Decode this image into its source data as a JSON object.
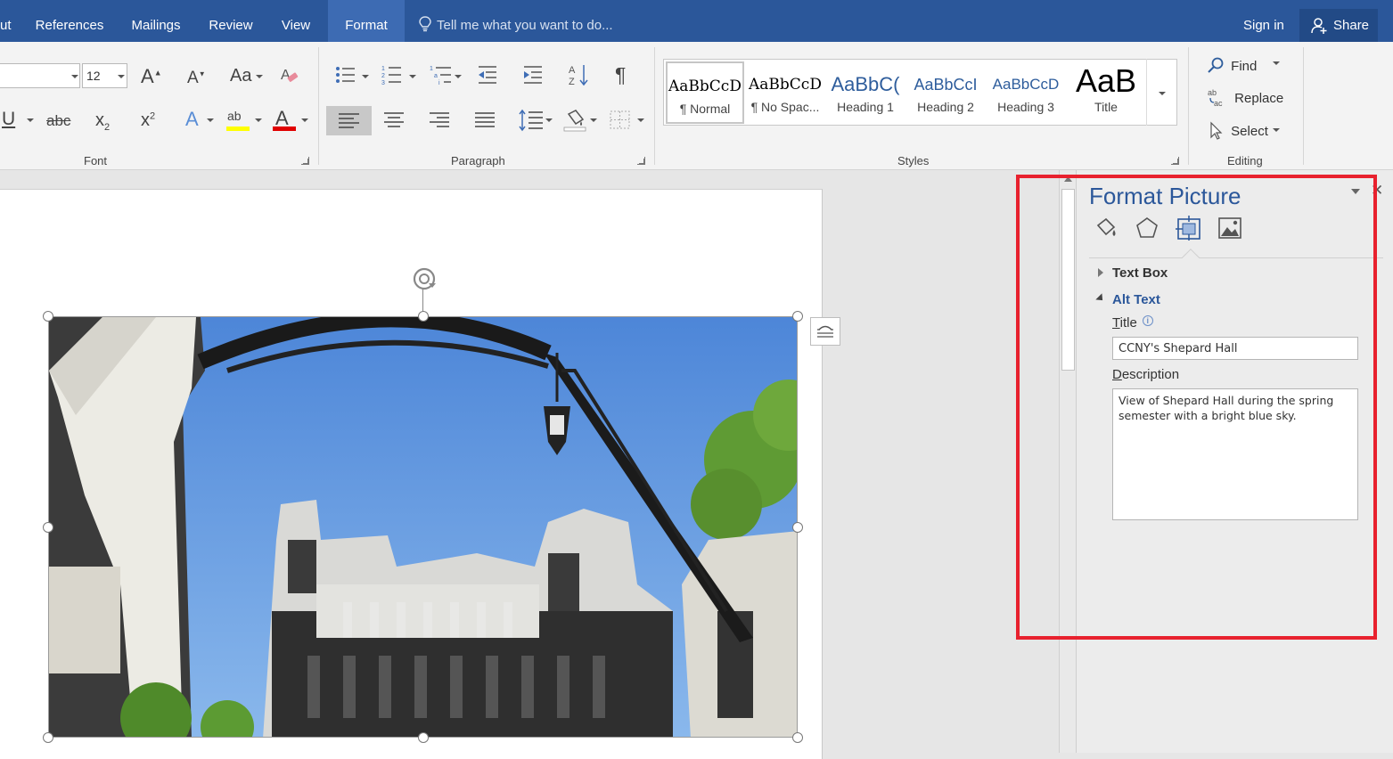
{
  "tabs": [
    {
      "label": "ut"
    },
    {
      "label": "References"
    },
    {
      "label": "Mailings"
    },
    {
      "label": "Review"
    },
    {
      "label": "View"
    },
    {
      "label": "Format"
    }
  ],
  "tell_me": {
    "placeholder": "Tell me what you want to do..."
  },
  "account": {
    "sign_in": "Sign in",
    "share": "Share"
  },
  "ribbon": {
    "font": {
      "group_label": "Font",
      "font_size": "12",
      "grow_font": "A",
      "shrink_font": "A",
      "change_case": "Aa",
      "underline": "U",
      "strikethrough": "abc",
      "subscript": "x",
      "subscript_mark": "2",
      "superscript": "x",
      "superscript_mark": "2",
      "text_effects": "A",
      "highlight": "ab",
      "font_color": "A"
    },
    "paragraph": {
      "group_label": "Paragraph",
      "pilcrow": "¶"
    },
    "styles": {
      "group_label": "Styles",
      "items": [
        {
          "sample": "AaBbCcD",
          "name": "¶ Normal"
        },
        {
          "sample": "AaBbCcD",
          "name": "¶ No Spac..."
        },
        {
          "sample": "AaBbC(",
          "name": "Heading 1"
        },
        {
          "sample": "AaBbCcI",
          "name": "Heading 2"
        },
        {
          "sample": "AaBbCcD",
          "name": "Heading 3"
        },
        {
          "sample": "AaB",
          "name": "Title"
        }
      ]
    },
    "editing": {
      "group_label": "Editing",
      "find": "Find",
      "replace": "Replace",
      "select": "Select"
    }
  },
  "format_pane": {
    "title": "Format Picture",
    "sections": {
      "text_box": "Text Box",
      "alt_text": "Alt Text"
    },
    "title_label_first": "T",
    "title_label_rest": "itle",
    "title_value": "CCNY's Shepard Hall",
    "description_label_first": "D",
    "description_label_rest": "escription",
    "description_value": "View of Shepard Hall during the spring semester with a bright blue sky."
  },
  "colors": {
    "tab_bar": "#2b579a",
    "accent": "#2b579a",
    "highlight_rect": "#e8212e"
  }
}
